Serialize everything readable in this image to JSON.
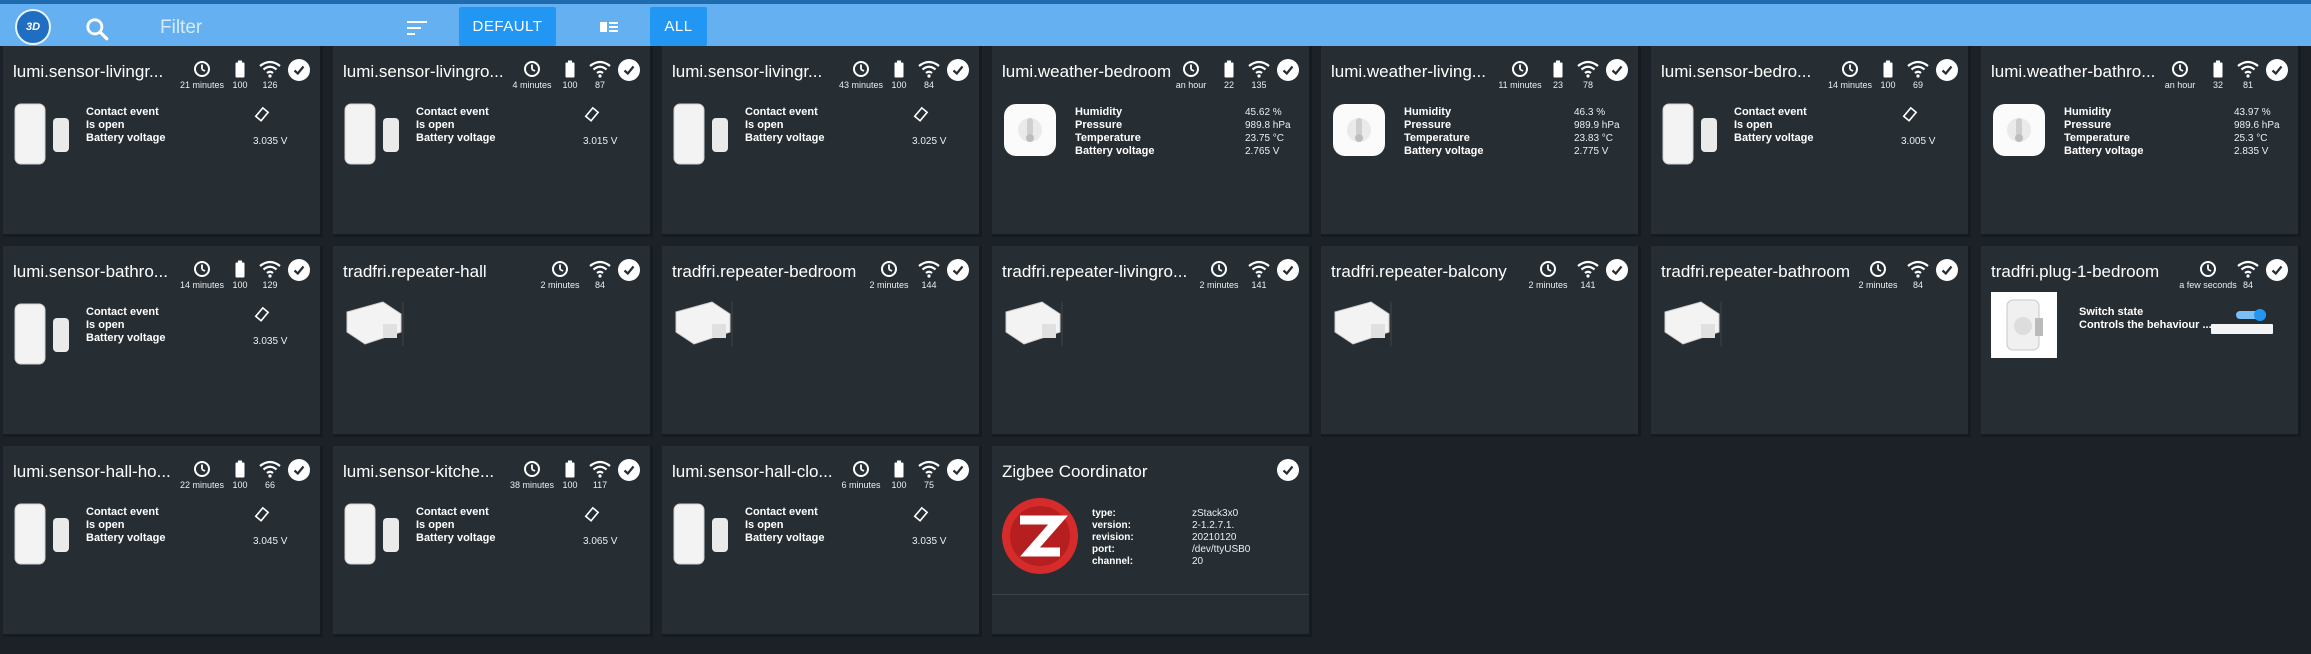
{
  "header": {
    "logo_text": "3D",
    "filter_placeholder": "Filter",
    "default_label": "DEFAULT",
    "all_label": "ALL",
    "accent_color": "#2196f3"
  },
  "cards": [
    {
      "title": "lumi.sensor-livingr...",
      "time": "21 minutes",
      "battery": "100",
      "link": "126",
      "props": [
        "Contact event",
        "Is open",
        "Battery voltage"
      ],
      "voltage": "3.035 V"
    },
    {
      "title": "lumi.sensor-livingro...",
      "time": "4 minutes",
      "battery": "100",
      "link": "87",
      "props": [
        "Contact event",
        "Is open",
        "Battery voltage"
      ],
      "voltage": "3.015 V"
    },
    {
      "title": "lumi.sensor-livingr...",
      "time": "43 minutes",
      "battery": "100",
      "link": "84",
      "props": [
        "Contact event",
        "Is open",
        "Battery voltage"
      ],
      "voltage": "3.025 V"
    },
    {
      "title": "lumi.weather-bedroom",
      "time": "an hour",
      "battery": "22",
      "link": "135",
      "props": [
        "Humidity",
        "Pressure",
        "Temperature",
        "Battery voltage"
      ],
      "values": [
        "45.62 %",
        "989.8 hPa",
        "23.75 °C",
        "2.765 V"
      ]
    },
    {
      "title": "lumi.weather-living...",
      "time": "11 minutes",
      "battery": "23",
      "link": "78",
      "props": [
        "Humidity",
        "Pressure",
        "Temperature",
        "Battery voltage"
      ],
      "values": [
        "46.3 %",
        "989.9 hPa",
        "23.83 °C",
        "2.775 V"
      ]
    },
    {
      "title": "lumi.sensor-bedro...",
      "time": "14 minutes",
      "battery": "100",
      "link": "69",
      "props": [
        "Contact event",
        "Is open",
        "Battery voltage"
      ],
      "voltage": "3.005 V"
    },
    {
      "title": "lumi.weather-bathro...",
      "time": "an hour",
      "battery": "32",
      "link": "81",
      "props": [
        "Humidity",
        "Pressure",
        "Temperature",
        "Battery voltage"
      ],
      "values": [
        "43.97 %",
        "989.6 hPa",
        "25.3 °C",
        "2.835 V"
      ]
    },
    {
      "title": "lumi.sensor-bathro...",
      "time": "14 minutes",
      "battery": "100",
      "link": "129",
      "props": [
        "Contact event",
        "Is open",
        "Battery voltage"
      ],
      "voltage": "3.035 V"
    },
    {
      "title": "tradfri.repeater-hall",
      "time": "2 minutes",
      "link": "84"
    },
    {
      "title": "tradfri.repeater-bedroom",
      "time": "2 minutes",
      "link": "144"
    },
    {
      "title": "tradfri.repeater-livingro...",
      "time": "2 minutes",
      "link": "141"
    },
    {
      "title": "tradfri.repeater-balcony",
      "time": "2 minutes",
      "link": "141"
    },
    {
      "title": "tradfri.repeater-bathroom",
      "time": "2 minutes",
      "link": "84"
    },
    {
      "title": "tradfri.plug-1-bedroom",
      "time": "a few seconds",
      "link": "84",
      "props": [
        "Switch state",
        "Controls the behaviour ..."
      ]
    },
    {
      "title": "lumi.sensor-hall-ho...",
      "time": "22 minutes",
      "battery": "100",
      "link": "66",
      "props": [
        "Contact event",
        "Is open",
        "Battery voltage"
      ],
      "voltage": "3.045 V"
    },
    {
      "title": "lumi.sensor-kitche...",
      "time": "38 minutes",
      "battery": "100",
      "link": "117",
      "props": [
        "Contact event",
        "Is open",
        "Battery voltage"
      ],
      "voltage": "3.065 V"
    },
    {
      "title": "lumi.sensor-hall-clo...",
      "time": "6 minutes",
      "battery": "100",
      "link": "75",
      "props": [
        "Contact event",
        "Is open",
        "Battery voltage"
      ],
      "voltage": "3.035 V"
    }
  ],
  "coordinator": {
    "title": "Zigbee Coordinator",
    "keys": [
      "type:",
      "version:",
      "revision:",
      "port:",
      "channel:"
    ],
    "values": [
      "zStack3x0",
      "2-1.2.7.1.",
      "20210120",
      "/dev/ttyUSB0",
      "20"
    ]
  }
}
